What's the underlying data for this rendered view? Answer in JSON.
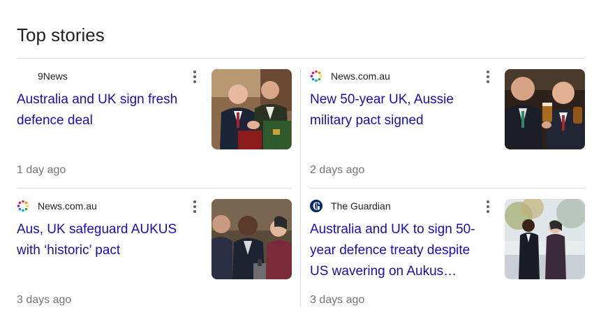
{
  "section": {
    "title": "Top stories"
  },
  "stories": [
    {
      "source": "9News",
      "source_icon": "none",
      "headline": "Australia and UK sign fresh defence deal",
      "time": "1 day ago",
      "image": "two-officials-handshake-photo"
    },
    {
      "source": "News.com.au",
      "source_icon": "news-com-au-dots-icon",
      "headline": "New 50-year UK, Aussie military pact signed",
      "time": "2 days ago",
      "image": "officials-raising-beer-glasses-photo"
    },
    {
      "source": "News.com.au",
      "source_icon": "news-com-au-dots-icon",
      "headline": "Aus, UK safeguard AUKUS with ‘historic’ pact",
      "time": "3 days ago",
      "image": "officials-at-press-conference-photo"
    },
    {
      "source": "The Guardian",
      "source_icon": "guardian-g-icon",
      "headline": "Australia and UK to sign 50-year defence treaty despite US wavering on Aukus…",
      "time": "3 days ago",
      "image": "two-officials-walking-outdoors-photo"
    }
  ],
  "colors": {
    "link": "#1a0dab",
    "meta": "#70757a",
    "divider": "#dadce0",
    "guardian": "#052962"
  }
}
